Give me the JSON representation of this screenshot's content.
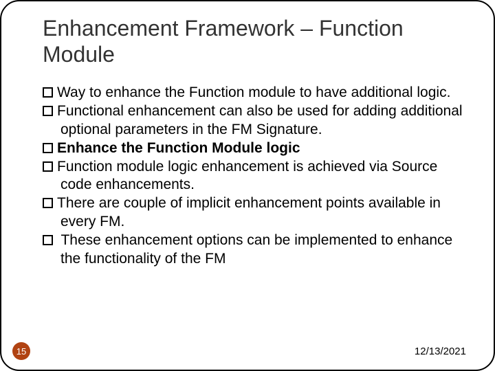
{
  "title": "Enhancement Framework – Function Module",
  "items": [
    {
      "text": "Way to enhance the Function module to have additional logic.",
      "bold": false,
      "leadingSpace": false
    },
    {
      "text": "Functional enhancement can also be used for adding additional optional parameters in the FM Signature.",
      "bold": false,
      "leadingSpace": false
    },
    {
      "text": "Enhance the Function Module logic",
      "bold": true,
      "leadingSpace": false
    },
    {
      "text": "Function module logic enhancement is achieved via Source code enhancements.",
      "bold": false,
      "leadingSpace": false
    },
    {
      "text": "There are couple of implicit enhancement points available in every FM.",
      "bold": false,
      "leadingSpace": false
    },
    {
      "text": " These enhancement options can be implemented to enhance the functionality of the FM",
      "bold": false,
      "leadingSpace": true
    }
  ],
  "pageNumber": "15",
  "date": "12/13/2021"
}
